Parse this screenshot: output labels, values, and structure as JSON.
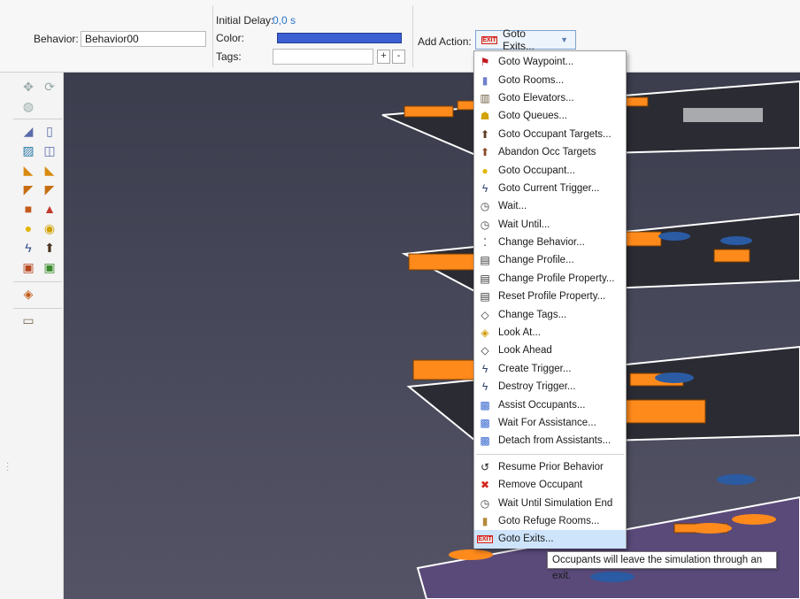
{
  "behavior": {
    "label": "Behavior:",
    "value": "Behavior00"
  },
  "initial_delay": {
    "label": "Initial Delay:",
    "value": "0,0 s"
  },
  "color": {
    "label": "Color:",
    "swatch": "#3c5fd4"
  },
  "tags": {
    "label": "Tags:",
    "value": "",
    "add": "+",
    "remove": "-"
  },
  "add_action": {
    "label": "Add Action:",
    "selected": "Goto Exits...",
    "exit_badge": "EXIT"
  },
  "menu": {
    "group1": [
      {
        "label": "Goto Waypoint...",
        "icon": "flag-icon"
      },
      {
        "label": "Goto Rooms...",
        "icon": "room-icon"
      },
      {
        "label": "Goto Elevators...",
        "icon": "elevator-icon"
      },
      {
        "label": "Goto Queues...",
        "icon": "queue-icon"
      },
      {
        "label": "Goto Occupant Targets...",
        "icon": "target-icon"
      },
      {
        "label": "Abandon Occ Targets",
        "icon": "abandon-target-icon"
      },
      {
        "label": "Goto Occupant...",
        "icon": "occupant-icon"
      },
      {
        "label": "Goto Current Trigger...",
        "icon": "trigger-icon"
      },
      {
        "label": "Wait...",
        "icon": "clock-icon"
      },
      {
        "label": "Wait Until...",
        "icon": "clock-icon"
      },
      {
        "label": "Change Behavior...",
        "icon": "footsteps-icon"
      },
      {
        "label": "Change Profile...",
        "icon": "profile-icon"
      },
      {
        "label": "Change Profile Property...",
        "icon": "profile-add-icon"
      },
      {
        "label": "Reset Profile Property...",
        "icon": "profile-remove-icon"
      },
      {
        "label": "Change Tags...",
        "icon": "tag-icon"
      },
      {
        "label": "Look At...",
        "icon": "look-at-icon"
      },
      {
        "label": "Look Ahead",
        "icon": "look-ahead-icon"
      },
      {
        "label": "Create Trigger...",
        "icon": "create-trigger-icon"
      },
      {
        "label": "Destroy Trigger...",
        "icon": "destroy-trigger-icon"
      },
      {
        "label": "Assist Occupants...",
        "icon": "assist-icon"
      },
      {
        "label": "Wait For Assistance...",
        "icon": "wait-assist-icon"
      },
      {
        "label": "Detach from Assistants...",
        "icon": "detach-icon"
      }
    ],
    "group2": [
      {
        "label": "Resume Prior Behavior",
        "icon": "resume-icon"
      },
      {
        "label": "Remove Occupant",
        "icon": "remove-occupant-icon"
      },
      {
        "label": "Wait Until Simulation End",
        "icon": "clock-icon"
      },
      {
        "label": "Goto Refuge Rooms...",
        "icon": "refuge-room-icon"
      },
      {
        "label": "Goto Exits...",
        "icon": "exit-icon"
      }
    ]
  },
  "tooltip": "Occupants will leave the simulation through an exit.",
  "colors": {
    "accent": "#2a73c9",
    "selection": "#cde4fb",
    "floor": "#ff8a1c",
    "view_bg": "#3b3d4d"
  }
}
